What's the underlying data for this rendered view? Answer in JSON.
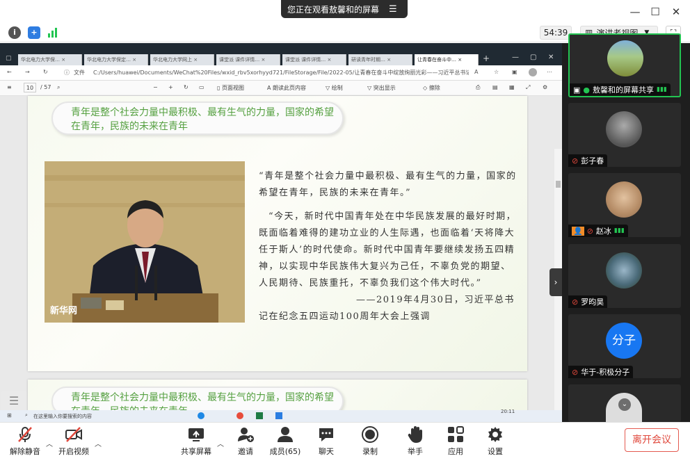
{
  "banner": {
    "text": "您正在观看敖馨和的屏幕"
  },
  "meeting": {
    "timer": "54:39",
    "view_mode": "演讲者视图"
  },
  "browser": {
    "tabs": [
      "华北电力大学保… ×",
      "华北电力大学保定… ×",
      "华北电力大学网上 ×",
      "课堂派 课件详情… ×",
      "课堂派 课件详情… ×",
      "研读青年时期… ×",
      "让青春在奋斗中… ×"
    ],
    "address": "C:/Users/huawei/Documents/WeChat%20Files/wxid_rbv5xorhyyd721/FileStorage/File/2022-05/让青春在奋斗中绽放绚丽光彩——习近平总书记关于青年工…",
    "address_label": "文件",
    "page_num": "10",
    "page_total": "/ 57",
    "tools": [
      "页面视图",
      "朗读此页内容",
      "绘制",
      "突出显示",
      "擦除"
    ]
  },
  "slide": {
    "heading": "青年是整个社会力量中最积极、最有生气的力量，国家的希望在青年，民族的未来在青年",
    "photo_caption": "新华网",
    "quote1": "“青年是整个社会力量中最积极、最有生气的力量，国家的希望在青年，民族的未来在青年。”",
    "quote2": "“今天，新时代中国青年处在中华民族发展的最好时期，既面临着难得的建功立业的人生际遇，也面临着‘天将降大任于斯人’的时代使命。新时代中国青年要继续发扬五四精神，以实现中华民族伟大复兴为己任，不辜负党的期望、人民期待、民族重托，不辜负我们这个伟大时代。”",
    "attribution": "——2019年4月30日，习近平总书记在纪念五四运动100周年大会上强调",
    "next_heading": "青年是整个社会力量中最积极、最有生气的力量，国家的希望在青年，民族的未来在青年"
  },
  "taskbar": {
    "search": "在这里输入你要搜索的内容",
    "time": "20:11"
  },
  "participants": [
    {
      "name": "敖馨和的屏幕共享"
    },
    {
      "name": "彭子春"
    },
    {
      "name": "赵冰"
    },
    {
      "name": "罗昀昊"
    },
    {
      "name": "华于-积极分子",
      "initials": "分子"
    }
  ],
  "toolbar": {
    "mute": "解除静音",
    "video": "开启视频",
    "share": "共享屏幕",
    "invite": "邀请",
    "members": "成员(65)",
    "chat": "聊天",
    "record": "录制",
    "raise_hand": "举手",
    "apps": "应用",
    "settings": "设置",
    "leave": "离开会议"
  },
  "colors": {
    "accent_green": "#23c552",
    "leave_red": "#e0483c",
    "heading_green": "#55a040",
    "info_blue": "#2f7de1"
  }
}
